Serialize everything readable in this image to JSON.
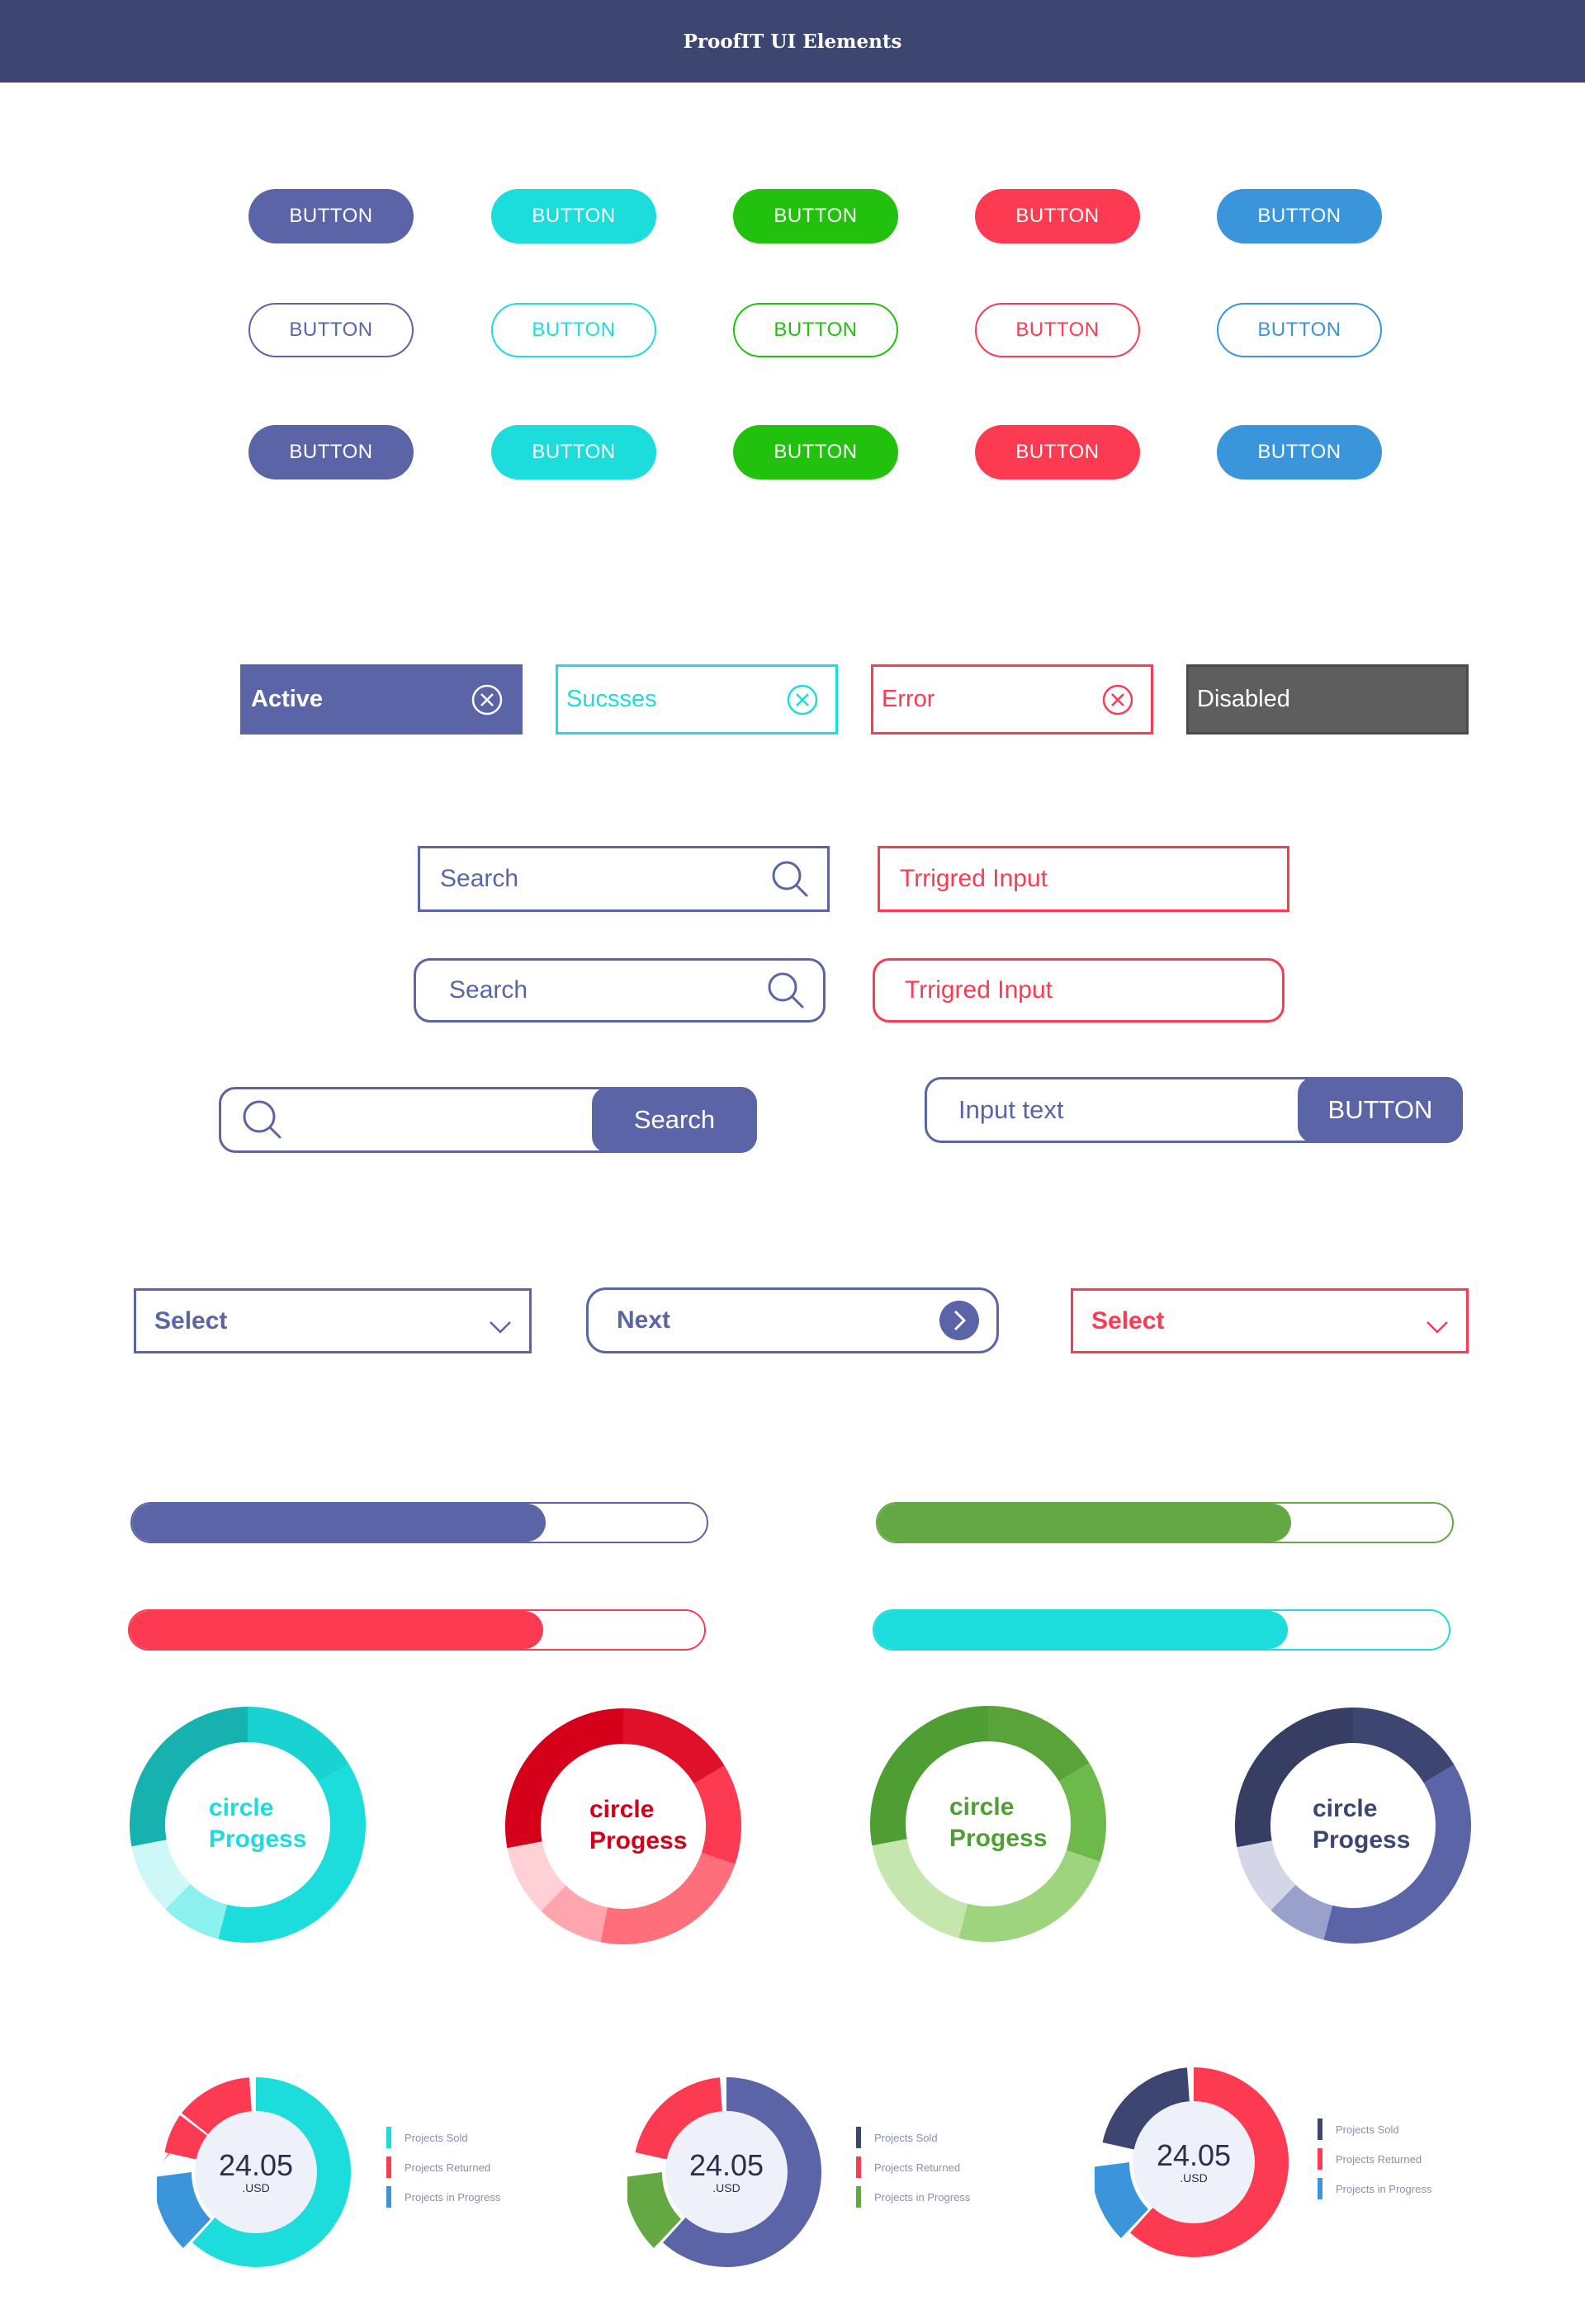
{
  "header": {
    "title": "ProofIT  UI Elements"
  },
  "buttons": {
    "label": "BUTTON",
    "colors": [
      "#5a64a6",
      "#1ddcdc",
      "#22c10e",
      "#fc3a52",
      "#3a95db"
    ]
  },
  "tags": [
    {
      "label": "Active",
      "variant": "active"
    },
    {
      "label": "Sucsses",
      "variant": "success"
    },
    {
      "label": "Error",
      "variant": "error"
    },
    {
      "label": "Disabled",
      "variant": "disabled"
    }
  ],
  "search": {
    "placeholder": "Search",
    "triggered_value": "Trrigred Input",
    "button_label": "Search",
    "input_text_placeholder": "Input text",
    "input_button_label": "BUTTON"
  },
  "selects": {
    "select_label": "Select",
    "next_label": "Next",
    "error_select_label": "Select"
  },
  "progress_bars": [
    {
      "color": "#5a64a6",
      "value": 0.72
    },
    {
      "color": "#63a843",
      "value": 0.72
    },
    {
      "color": "#fc3a52",
      "value": 0.72
    },
    {
      "color": "#1ddcdc",
      "value": 0.72
    }
  ],
  "circle_progress": {
    "label_line1": "circle",
    "label_line2": "Progess",
    "items": [
      {
        "text_color": "#1ddcdc"
      },
      {
        "text_color": "#d5001a"
      },
      {
        "text_color": "#4f9e34"
      },
      {
        "text_color": "#3d4670"
      }
    ]
  },
  "donuts": {
    "value": "24.05",
    "currency": ".USD",
    "legend": [
      "Projects Sold",
      "Projects Returned",
      "Projects in Progress"
    ],
    "items": [
      {
        "legend_colors": [
          "#1ddcdc",
          "#fc3a52",
          "#3a95db"
        ]
      },
      {
        "legend_colors": [
          "#3d4670",
          "#fc3a52",
          "#63a843"
        ]
      },
      {
        "legend_colors": [
          "#3d4670",
          "#fc3a52",
          "#3a95db"
        ]
      }
    ]
  }
}
